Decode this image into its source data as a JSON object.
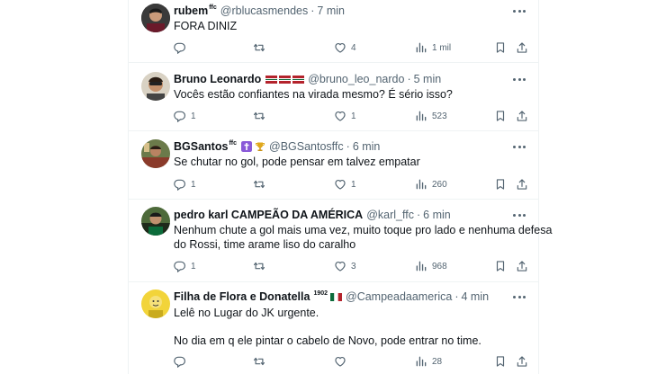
{
  "tweets": [
    {
      "name": "rubem",
      "name_sup": "ffc",
      "handle": "@rblucasmendes",
      "time": "7 min",
      "text": "FORA DINIZ",
      "replies": "",
      "likes": "4",
      "views": "1 mil"
    },
    {
      "name": "Bruno Leonardo",
      "handle": "@bruno_leo_nardo",
      "time": "5 min",
      "text": "Vocês estão confiantes na virada mesmo? É sério isso?",
      "replies": "1",
      "likes": "1",
      "views": "523"
    },
    {
      "name": "BGSantos",
      "name_sup": "ffc",
      "handle": "@BGSantosffc",
      "time": "6 min",
      "text": "Se chutar no gol, pode pensar em talvez empatar",
      "replies": "1",
      "likes": "1",
      "views": "260"
    },
    {
      "name": "pedro karl CAMPEÃO DA AMÉRICA",
      "handle": "@karl_ffc",
      "time": "6 min",
      "text_line1": "Nenhum chute a gol mais uma vez, muito toque pro lado e nenhuma defesa",
      "text_line2": "do Rossi, time arame liso do caralho",
      "replies": "1",
      "likes": "3",
      "views": "968"
    },
    {
      "name": "Filha de Flora e Donatella",
      "name_sup": "1902",
      "handle": "@Campeadaamerica",
      "time": "4 min",
      "text_line1": "Lelê no Lugar do JK urgente.",
      "text_line2": "No dia em q ele pintar o cabelo de Novo, pode entrar no time.",
      "replies": "",
      "likes": "",
      "views": "28"
    }
  ],
  "separator": "·",
  "icons": [
    "reply-icon",
    "retweet-icon",
    "like-icon",
    "views-icon",
    "bookmark-icon",
    "share-icon",
    "more-icon"
  ],
  "colors": {
    "text": "#0f1419",
    "secondary": "#536471",
    "border": "#eff3f4",
    "flamengo_red": "#b4232c",
    "fluminense_green": "#0b6b3a",
    "fluminense_red": "#8a1538"
  }
}
